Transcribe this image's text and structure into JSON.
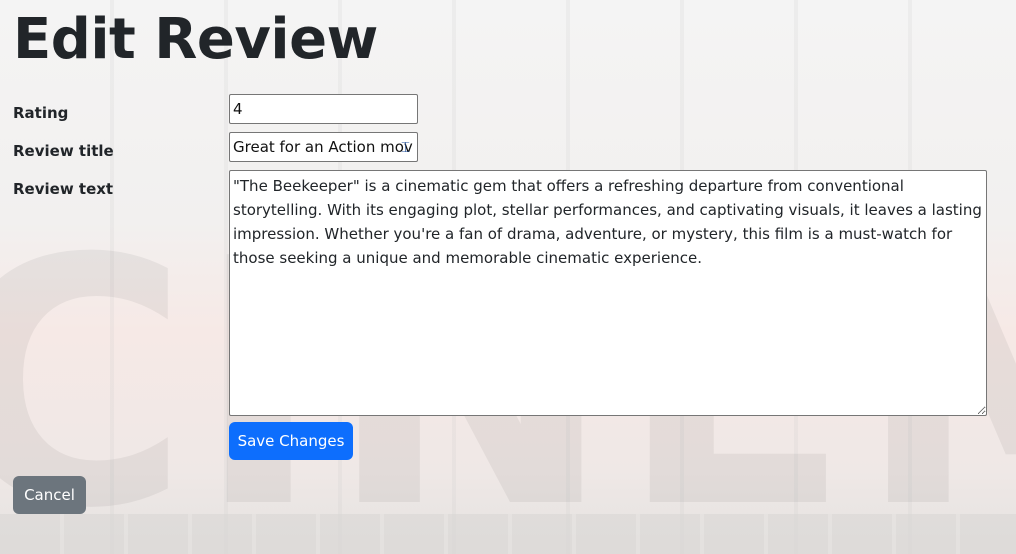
{
  "page": {
    "title": "Edit Review",
    "background_word": "CINEMA"
  },
  "form": {
    "rating": {
      "label": "Rating",
      "value": "4"
    },
    "review_title": {
      "label": "Review title",
      "value": "Great for an Action movie"
    },
    "review_text": {
      "label": "Review text",
      "value": "\"The Beekeeper\" is a cinematic gem that offers a refreshing departure from conventional storytelling. With its engaging plot, stellar performances, and captivating visuals, it leaves a lasting impression. Whether you're a fan of drama, adventure, or mystery, this film is a must-watch for those seeking a unique and memorable cinematic experience."
    },
    "save_label": "Save Changes",
    "cancel_label": "Cancel"
  },
  "colors": {
    "primary_button": "#0d6efd",
    "secondary_button": "#6c757d",
    "text": "#212529"
  },
  "icons": {
    "text_cursor": "text-cursor-icon"
  }
}
